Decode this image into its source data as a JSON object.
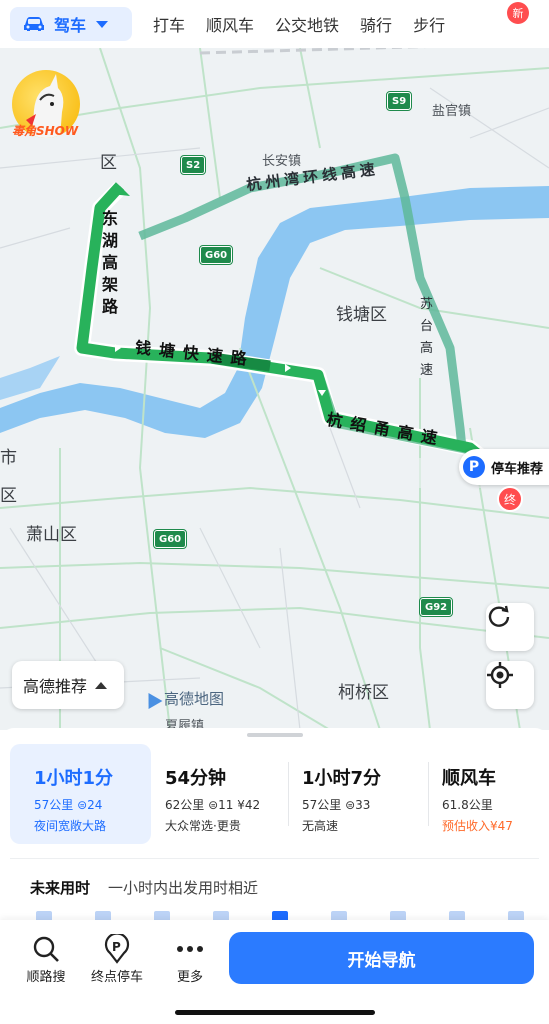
{
  "topbar": {
    "active_mode": "驾车",
    "tabs": [
      "打车",
      "顺风车",
      "公交地铁",
      "骑行",
      "步行"
    ],
    "new_badge": "新"
  },
  "map": {
    "avatar_text": "毒角SHOW",
    "districts": {
      "top_left": "区",
      "qiantang": "钱塘区",
      "left_city": "市",
      "left_qu": "区",
      "xiaoshan": "萧山区",
      "keqiao": "柯桥区",
      "bottom_cut": "夏履镇"
    },
    "towns": {
      "changan": "长安镇",
      "yanguan": "盐官镇"
    },
    "shields": {
      "s9": "S9",
      "s2": "S2",
      "g60_top": "G60",
      "g60_bottom": "G60",
      "g92": "G92"
    },
    "roads": {
      "hangzhou_bay": "杭州湾环线高速",
      "donghu": "东湖高架路",
      "qiantang_exp": "钱塘快速路",
      "hangshaoyong": "杭绍甬高速",
      "sutai": "苏台高速"
    },
    "parking_label": "停车推荐",
    "parking_symbol": "P",
    "end_marker": "终",
    "recommend_label": "高德推荐",
    "logo_text": "高德地图"
  },
  "routes": [
    {
      "time": "1小时1分",
      "line2": "57公里 ⊜24",
      "line3": "夜间宽敞大路",
      "selected": true
    },
    {
      "time": "54分钟",
      "line2": "62公里 ⊜11 ¥42",
      "line3": "大众常选·更贵"
    },
    {
      "time": "1小时7分",
      "line2": "57公里 ⊜33",
      "line3": "无高速"
    },
    {
      "time": "顺风车",
      "line2": "61.8公里",
      "line3": "预估收入¥47"
    }
  ],
  "future": {
    "title": "未来用时",
    "desc": "一小时内出发用时相近",
    "highlight_index": 4
  },
  "actions": {
    "along_search": "顺路搜",
    "end_parking": "终点停车",
    "more": "更多",
    "start_nav": "开始导航"
  },
  "colors": {
    "accent": "#1d6cff",
    "route_green": "#2bb35f",
    "river": "#7fbff0"
  }
}
